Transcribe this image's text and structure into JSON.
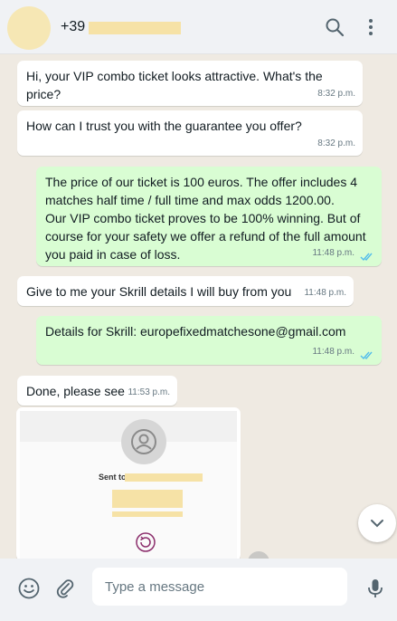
{
  "header": {
    "contact_prefix": "+39",
    "icons": [
      "search-icon",
      "menu-icon"
    ]
  },
  "messages": [
    {
      "direction": "in",
      "text": "Hi, your VIP combo ticket looks attractive. What's the price?",
      "time": "8:32 p.m."
    },
    {
      "direction": "in",
      "text": "How can I trust you with the guarantee you offer?",
      "time": "8:32 p.m."
    },
    {
      "direction": "out",
      "text": "The price of our ticket is 100 euros. The offer includes 4 matches half time / full time and max odds 1200.00.\nOur VIP combo ticket proves to be 100% winning. But of course for your safety we offer a refund of the full amount you paid in case of loss.",
      "time": "11:48 p.m.",
      "read": true
    },
    {
      "direction": "in",
      "text": "Give to me your Skrill details I will buy from you",
      "time": "11:48 p.m."
    },
    {
      "direction": "out",
      "text": "Details for Skrill: europefixedmatchesone@gmail.com",
      "time": "11:48 p.m.",
      "read": true
    },
    {
      "direction": "in",
      "text": "Done, please see",
      "time": "11:53 p.m."
    }
  ],
  "image_message": {
    "sent_to_label": "Sent to"
  },
  "footer": {
    "placeholder": "Type a message"
  },
  "colors": {
    "incoming_bubble": "#ffffff",
    "outgoing_bubble": "#d9fdd3",
    "read_ticks": "#53bdeb"
  }
}
